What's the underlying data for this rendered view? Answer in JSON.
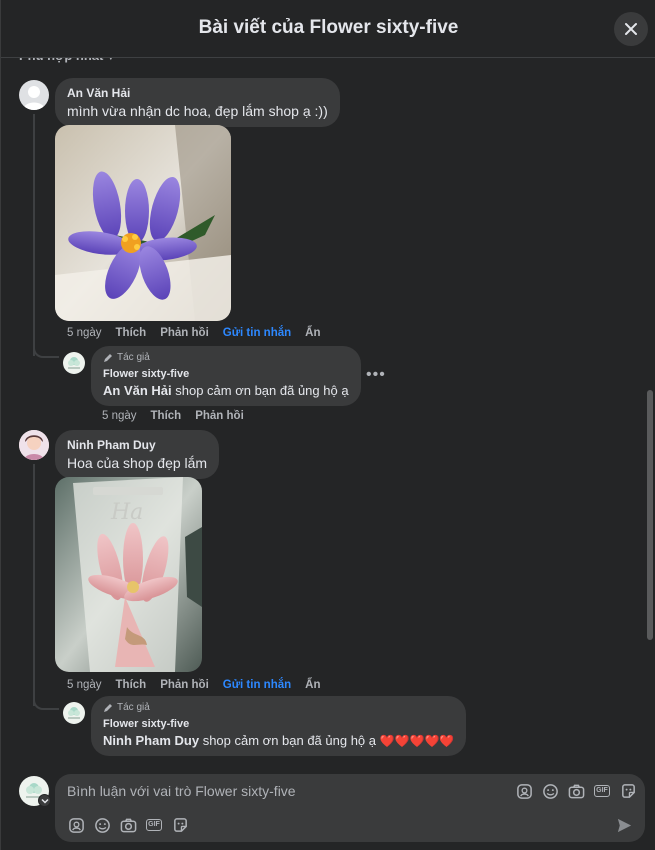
{
  "header": {
    "title": "Bài viết của Flower sixty-five"
  },
  "sort": {
    "label": "Phù hợp nhất"
  },
  "comments": [
    {
      "author": "An Văn Hải",
      "text": "mình vừa nhận dc hoa, đẹp lắm shop ạ :))",
      "actions": {
        "time": "5 ngày",
        "like": "Thích",
        "reply": "Phản hồi",
        "message": "Gửi tin nhắn",
        "hide": "Ẩn"
      },
      "reply": {
        "badge": "Tác giả",
        "author": "Flower sixty-five",
        "mention": "An Văn Hải",
        "text": " shop cảm ơn bạn đã ủng hộ ạ",
        "actions": {
          "time": "5 ngày",
          "like": "Thích",
          "reply": "Phản hồi"
        }
      }
    },
    {
      "author": "Ninh Pham Duy",
      "text": "Hoa của shop đẹp lắm",
      "actions": {
        "time": "5 ngày",
        "like": "Thích",
        "reply": "Phản hồi",
        "message": "Gửi tin nhắn",
        "hide": "Ẩn"
      },
      "reply": {
        "badge": "Tác giả",
        "author": "Flower sixty-five",
        "mention": "Ninh Pham Duy",
        "text": " shop cảm ơn bạn đã ủng hộ ạ ",
        "hearts": "❤️❤️❤️❤️❤️",
        "actions": {}
      }
    }
  ],
  "composer": {
    "placeholder": "Bình luận với vai trò Flower sixty-five"
  },
  "colors": {
    "background": "#242526",
    "bubble": "#3a3b3c",
    "link": "#2d88ff",
    "muted": "#b0b3b8",
    "text": "#e4e6eb"
  }
}
